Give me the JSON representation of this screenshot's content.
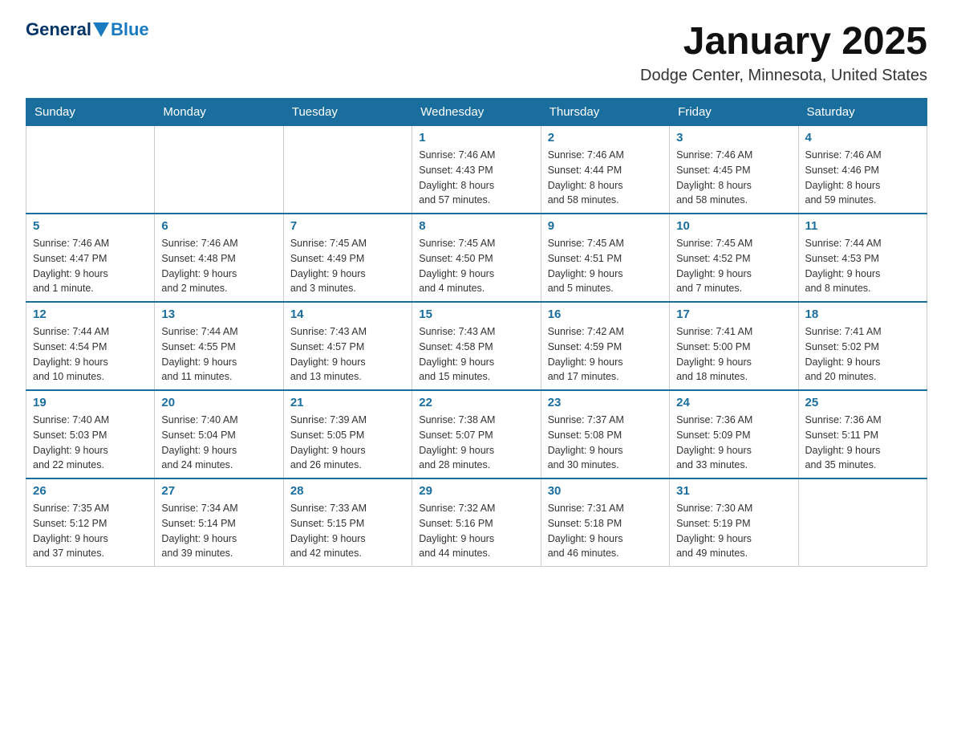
{
  "header": {
    "logo_general": "General",
    "logo_blue": "Blue",
    "title": "January 2025",
    "subtitle": "Dodge Center, Minnesota, United States"
  },
  "days_of_week": [
    "Sunday",
    "Monday",
    "Tuesday",
    "Wednesday",
    "Thursday",
    "Friday",
    "Saturday"
  ],
  "weeks": [
    [
      {
        "day": "",
        "info": ""
      },
      {
        "day": "",
        "info": ""
      },
      {
        "day": "",
        "info": ""
      },
      {
        "day": "1",
        "info": "Sunrise: 7:46 AM\nSunset: 4:43 PM\nDaylight: 8 hours\nand 57 minutes."
      },
      {
        "day": "2",
        "info": "Sunrise: 7:46 AM\nSunset: 4:44 PM\nDaylight: 8 hours\nand 58 minutes."
      },
      {
        "day": "3",
        "info": "Sunrise: 7:46 AM\nSunset: 4:45 PM\nDaylight: 8 hours\nand 58 minutes."
      },
      {
        "day": "4",
        "info": "Sunrise: 7:46 AM\nSunset: 4:46 PM\nDaylight: 8 hours\nand 59 minutes."
      }
    ],
    [
      {
        "day": "5",
        "info": "Sunrise: 7:46 AM\nSunset: 4:47 PM\nDaylight: 9 hours\nand 1 minute."
      },
      {
        "day": "6",
        "info": "Sunrise: 7:46 AM\nSunset: 4:48 PM\nDaylight: 9 hours\nand 2 minutes."
      },
      {
        "day": "7",
        "info": "Sunrise: 7:45 AM\nSunset: 4:49 PM\nDaylight: 9 hours\nand 3 minutes."
      },
      {
        "day": "8",
        "info": "Sunrise: 7:45 AM\nSunset: 4:50 PM\nDaylight: 9 hours\nand 4 minutes."
      },
      {
        "day": "9",
        "info": "Sunrise: 7:45 AM\nSunset: 4:51 PM\nDaylight: 9 hours\nand 5 minutes."
      },
      {
        "day": "10",
        "info": "Sunrise: 7:45 AM\nSunset: 4:52 PM\nDaylight: 9 hours\nand 7 minutes."
      },
      {
        "day": "11",
        "info": "Sunrise: 7:44 AM\nSunset: 4:53 PM\nDaylight: 9 hours\nand 8 minutes."
      }
    ],
    [
      {
        "day": "12",
        "info": "Sunrise: 7:44 AM\nSunset: 4:54 PM\nDaylight: 9 hours\nand 10 minutes."
      },
      {
        "day": "13",
        "info": "Sunrise: 7:44 AM\nSunset: 4:55 PM\nDaylight: 9 hours\nand 11 minutes."
      },
      {
        "day": "14",
        "info": "Sunrise: 7:43 AM\nSunset: 4:57 PM\nDaylight: 9 hours\nand 13 minutes."
      },
      {
        "day": "15",
        "info": "Sunrise: 7:43 AM\nSunset: 4:58 PM\nDaylight: 9 hours\nand 15 minutes."
      },
      {
        "day": "16",
        "info": "Sunrise: 7:42 AM\nSunset: 4:59 PM\nDaylight: 9 hours\nand 17 minutes."
      },
      {
        "day": "17",
        "info": "Sunrise: 7:41 AM\nSunset: 5:00 PM\nDaylight: 9 hours\nand 18 minutes."
      },
      {
        "day": "18",
        "info": "Sunrise: 7:41 AM\nSunset: 5:02 PM\nDaylight: 9 hours\nand 20 minutes."
      }
    ],
    [
      {
        "day": "19",
        "info": "Sunrise: 7:40 AM\nSunset: 5:03 PM\nDaylight: 9 hours\nand 22 minutes."
      },
      {
        "day": "20",
        "info": "Sunrise: 7:40 AM\nSunset: 5:04 PM\nDaylight: 9 hours\nand 24 minutes."
      },
      {
        "day": "21",
        "info": "Sunrise: 7:39 AM\nSunset: 5:05 PM\nDaylight: 9 hours\nand 26 minutes."
      },
      {
        "day": "22",
        "info": "Sunrise: 7:38 AM\nSunset: 5:07 PM\nDaylight: 9 hours\nand 28 minutes."
      },
      {
        "day": "23",
        "info": "Sunrise: 7:37 AM\nSunset: 5:08 PM\nDaylight: 9 hours\nand 30 minutes."
      },
      {
        "day": "24",
        "info": "Sunrise: 7:36 AM\nSunset: 5:09 PM\nDaylight: 9 hours\nand 33 minutes."
      },
      {
        "day": "25",
        "info": "Sunrise: 7:36 AM\nSunset: 5:11 PM\nDaylight: 9 hours\nand 35 minutes."
      }
    ],
    [
      {
        "day": "26",
        "info": "Sunrise: 7:35 AM\nSunset: 5:12 PM\nDaylight: 9 hours\nand 37 minutes."
      },
      {
        "day": "27",
        "info": "Sunrise: 7:34 AM\nSunset: 5:14 PM\nDaylight: 9 hours\nand 39 minutes."
      },
      {
        "day": "28",
        "info": "Sunrise: 7:33 AM\nSunset: 5:15 PM\nDaylight: 9 hours\nand 42 minutes."
      },
      {
        "day": "29",
        "info": "Sunrise: 7:32 AM\nSunset: 5:16 PM\nDaylight: 9 hours\nand 44 minutes."
      },
      {
        "day": "30",
        "info": "Sunrise: 7:31 AM\nSunset: 5:18 PM\nDaylight: 9 hours\nand 46 minutes."
      },
      {
        "day": "31",
        "info": "Sunrise: 7:30 AM\nSunset: 5:19 PM\nDaylight: 9 hours\nand 49 minutes."
      },
      {
        "day": "",
        "info": ""
      }
    ]
  ]
}
